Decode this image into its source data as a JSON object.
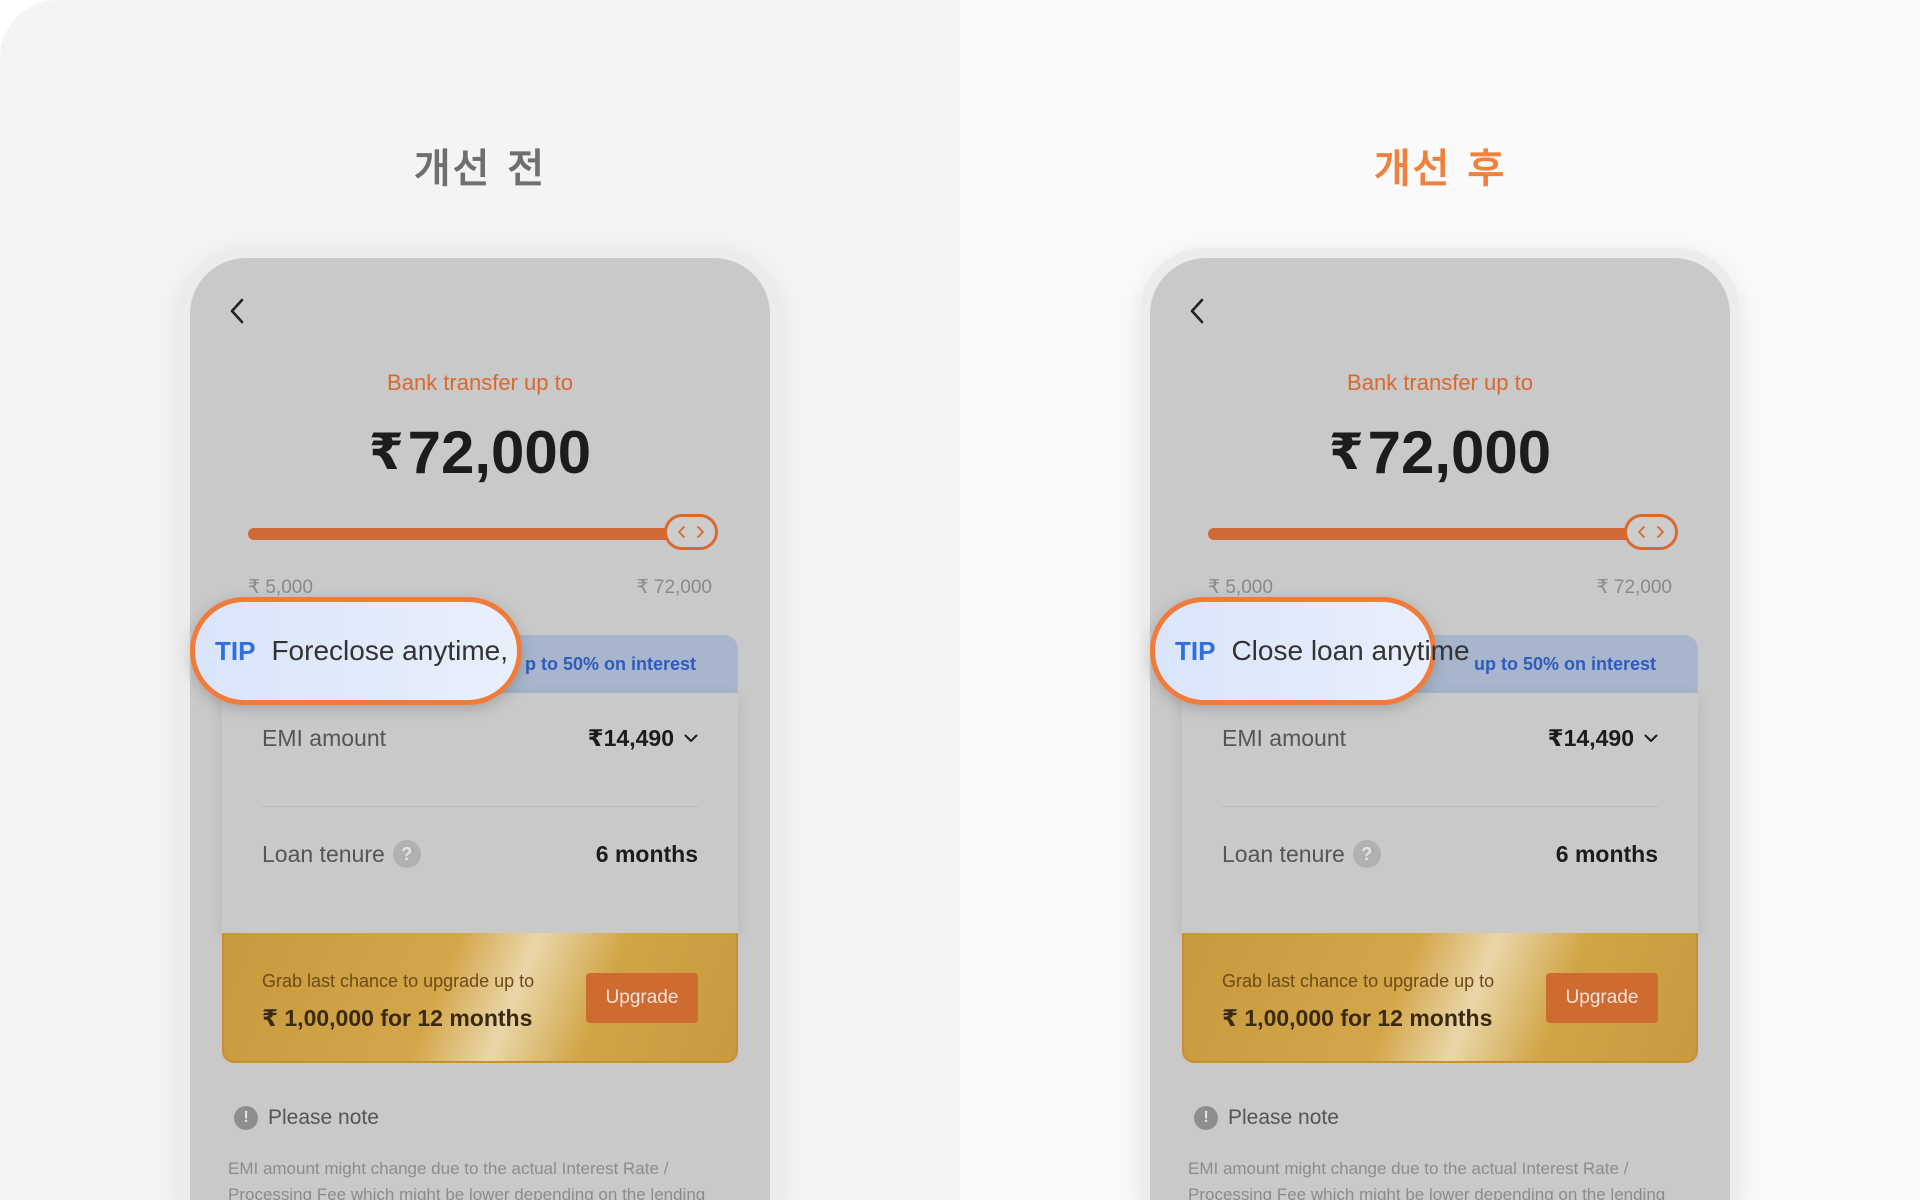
{
  "before": {
    "heading": "개선 전",
    "screen": {
      "bank_label": "Bank transfer up to",
      "currency_symbol": "₹",
      "amount": "72,000",
      "slider": {
        "min_label": "₹ 5,000",
        "max_label": "₹ 72,000",
        "position_fraction": 1.0
      },
      "promo_text": "p to 50% on interest",
      "emi": {
        "label": "EMI amount",
        "value": "₹14,490"
      },
      "tenure": {
        "label": "Loan tenure",
        "value": "6 months"
      },
      "upgrade": {
        "line1": "Grab last chance to upgrade up to",
        "line2": "₹ 1,00,000 for 12 months",
        "button": "Upgrade"
      },
      "note": {
        "title": "Please note",
        "body": "EMI amount might change due to the actual Interest Rate / Processing Fee which might be lower depending on the lending"
      }
    },
    "tip": {
      "tag": "TIP",
      "text": "Foreclose anytime,"
    }
  },
  "after": {
    "heading": "개선 후",
    "screen": {
      "bank_label": "Bank transfer up to",
      "currency_symbol": "₹",
      "amount": "72,000",
      "slider": {
        "min_label": "₹ 5,000",
        "max_label": "₹ 72,000",
        "position_fraction": 1.0
      },
      "promo_text": "up to 50% on interest",
      "emi": {
        "label": "EMI amount",
        "value": "₹14,490"
      },
      "tenure": {
        "label": "Loan tenure",
        "value": "6 months"
      },
      "upgrade": {
        "line1": "Grab last chance to upgrade up to",
        "line2": "₹ 1,00,000 for 12 months",
        "button": "Upgrade"
      },
      "note": {
        "title": "Please note",
        "body": "EMI amount might change due to the actual Interest Rate / Processing Fee which might be lower depending on the lending"
      }
    },
    "tip": {
      "tag": "TIP",
      "text": "Close loan anytime"
    }
  },
  "colors": {
    "accent_before": "#6f6f6f",
    "accent_after": "#f0803c",
    "brand_orange": "#d9692f",
    "tip_blue": "#2f6fe2",
    "promo_blue": "#2e5bbd"
  },
  "icons": [
    "back-chevron-icon",
    "slider-arrows-icon",
    "chevron-down-icon",
    "help-icon",
    "info-icon"
  ]
}
